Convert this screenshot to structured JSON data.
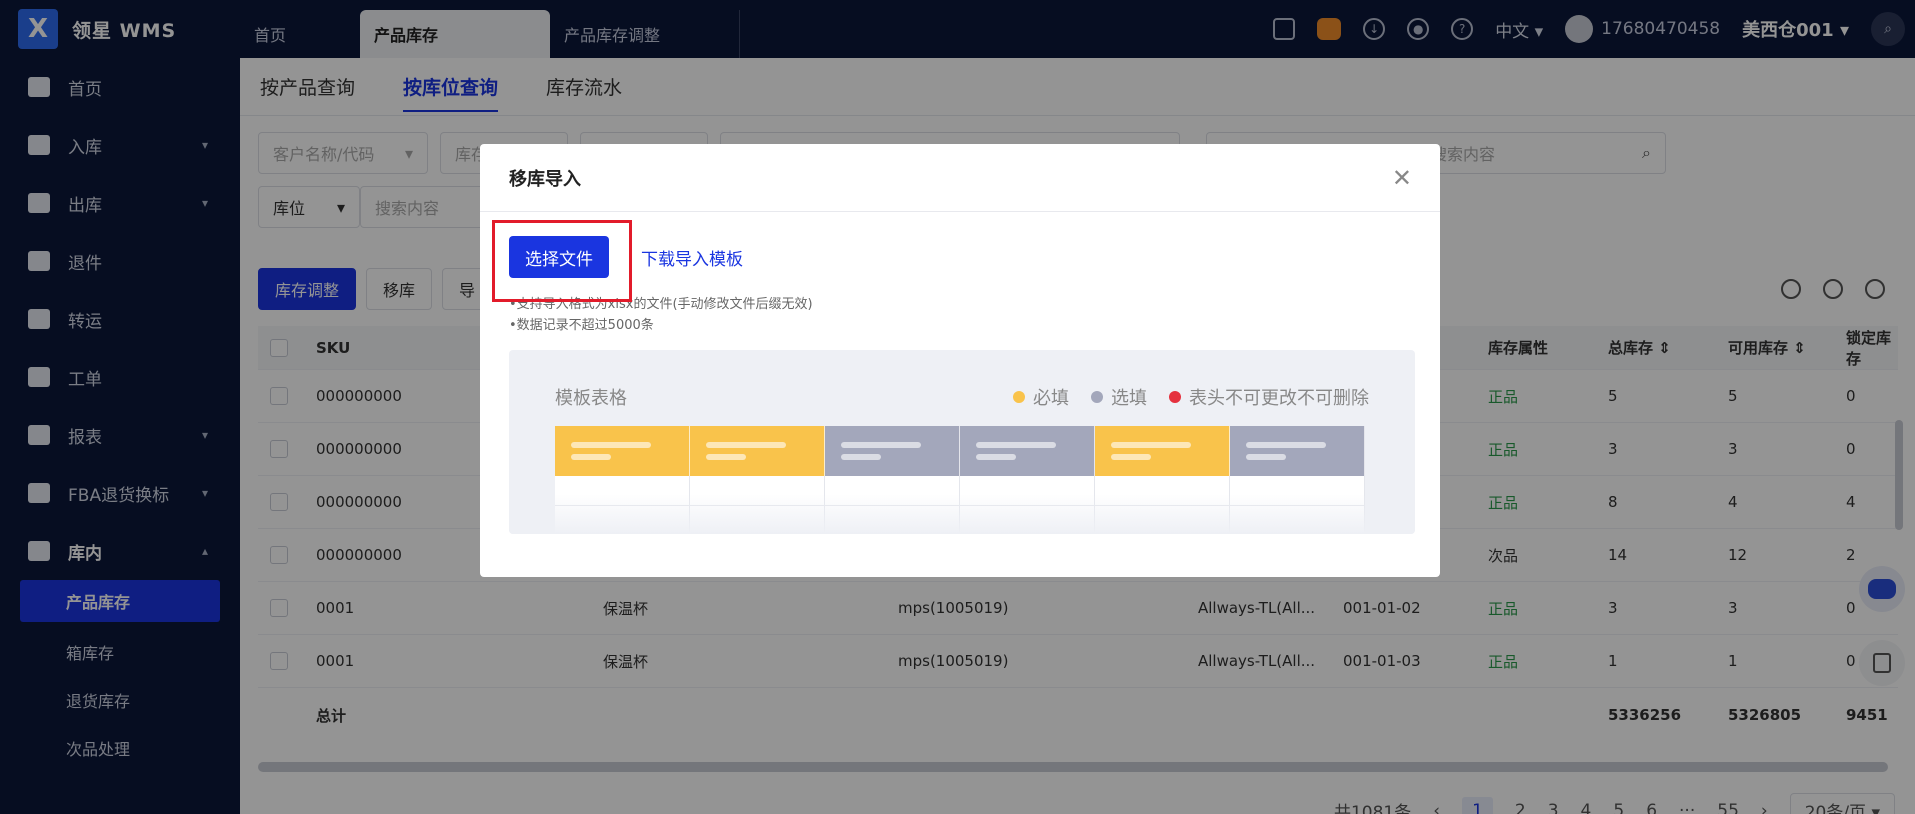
{
  "app": {
    "brand": "领星 WMS"
  },
  "top_tabs": [
    "首页",
    "产品库存",
    "产品库存调整"
  ],
  "top_right": {
    "language": "中文",
    "phone": "17680470458",
    "warehouse": "美西仓001"
  },
  "sidebar": {
    "items": [
      {
        "label": "首页"
      },
      {
        "label": "入库"
      },
      {
        "label": "出库"
      },
      {
        "label": "退件"
      },
      {
        "label": "转运"
      },
      {
        "label": "工单"
      },
      {
        "label": "报表"
      },
      {
        "label": "FBA退货换标"
      },
      {
        "label": "库内"
      }
    ],
    "sub_items": [
      "产品库存",
      "箱库存",
      "退货库存",
      "次品处理"
    ]
  },
  "sub_tabs": [
    "按产品查询",
    "按库位查询",
    "库存流水"
  ],
  "filters": {
    "customer_placeholder": "客户名称/代码",
    "stock_placeholder": "库存",
    "search_placeholder": "搜索内容",
    "location_label": "库位",
    "search2_placeholder": "搜索内容"
  },
  "actions": [
    "库存调整",
    "移库",
    "导"
  ],
  "table": {
    "headers": {
      "sku": "SKU",
      "attr": "库存属性",
      "total": "总库存",
      "avail": "可用库存",
      "locked": "锁定库存"
    },
    "rows": [
      {
        "sku": "000000000",
        "name": "",
        "mps": "",
        "wh": "",
        "loc": "",
        "attr": "正品",
        "total": "5",
        "avail": "5",
        "locked": "0"
      },
      {
        "sku": "000000000",
        "name": "",
        "mps": "",
        "wh": "",
        "loc": "",
        "attr": "正品",
        "total": "3",
        "avail": "3",
        "locked": "0"
      },
      {
        "sku": "000000000",
        "name": "",
        "mps": "",
        "wh": "",
        "loc": "",
        "attr": "正品",
        "total": "8",
        "avail": "4",
        "locked": "4"
      },
      {
        "sku": "000000000",
        "name": "",
        "mps": "",
        "wh": "",
        "loc": "",
        "attr": "次品",
        "total": "14",
        "avail": "12",
        "locked": "2"
      },
      {
        "sku": "0001",
        "name": "保温杯",
        "mps": "mps(1005019)",
        "wh": "Allways-TL(All...",
        "loc": "001-01-02",
        "attr": "正品",
        "total": "3",
        "avail": "3",
        "locked": "0"
      },
      {
        "sku": "0001",
        "name": "保温杯",
        "mps": "mps(1005019)",
        "wh": "Allways-TL(All...",
        "loc": "001-01-03",
        "attr": "正品",
        "total": "1",
        "avail": "1",
        "locked": "0"
      }
    ],
    "total_row": {
      "label": "总计",
      "total": "5336256",
      "avail": "5326805",
      "locked": "9451"
    }
  },
  "pager": {
    "count": "共1081条",
    "pages": [
      "1",
      "2",
      "3",
      "4",
      "5",
      "6",
      "···",
      "55"
    ],
    "size": "20条/页"
  },
  "modal": {
    "title": "移库导入",
    "choose_file": "选择文件",
    "download_template": "下载导入模板",
    "tip1": "•支持导入格式为xlsx的文件(手动修改文件后缀无效)",
    "tip2": "•数据记录不超过5000条",
    "template_title": "模板表格",
    "legend": [
      {
        "label": "必填",
        "color": "#f9c34b"
      },
      {
        "label": "选填",
        "color": "#a3a7bb"
      },
      {
        "label": "表头不可更改不可删除",
        "color": "#e5323f"
      }
    ],
    "template_header_colors": [
      "#f9c34b",
      "#f9c34b",
      "#a3a7bb",
      "#a3a7bb",
      "#f9c34b",
      "#a3a7bb"
    ]
  }
}
